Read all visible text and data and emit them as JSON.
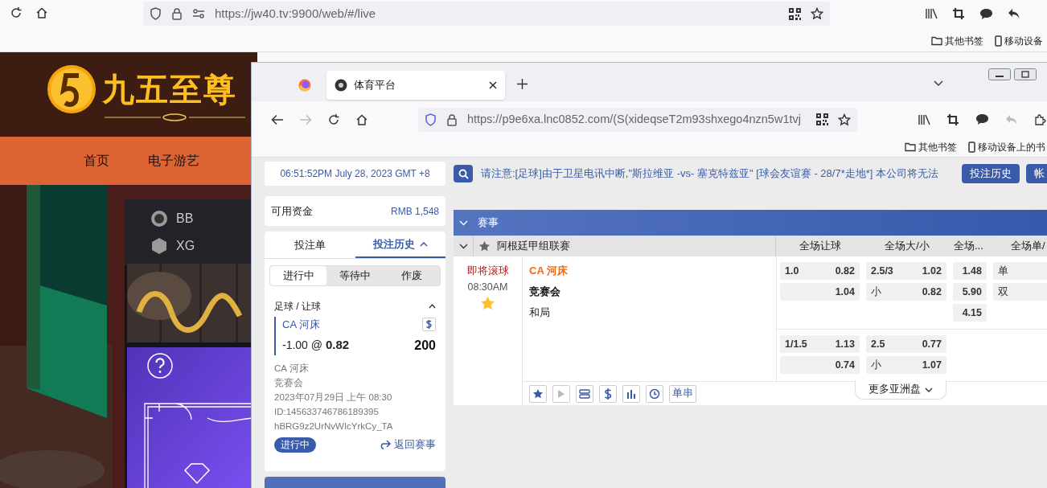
{
  "outer_browser": {
    "url": "https://jw40.tv:9900/web/#/live",
    "bookmarks": [
      "其他书签",
      "移动设备"
    ]
  },
  "site": {
    "brand": "九五至尊",
    "nav": [
      "首页",
      "电子游艺"
    ],
    "providers": [
      "BB",
      "XG"
    ]
  },
  "inner_browser": {
    "tab_title": "体育平台",
    "url": "https://p9e6xa.lnc0852.com/(S(xideqseT2m93shxego4nzn5w1tvj",
    "bookmarks": [
      "其他书签",
      "移动设备上的书"
    ]
  },
  "clock": "06:51:52PM July 28, 2023 GMT +8",
  "notice": "请注意:[足球]由于卫星电讯中断,\"斯拉维亚 -vs- 塞克特兹亚\" [球会友谊赛 - 28/7*走地*] 本公司将无法",
  "header_buttons": [
    "投注历史",
    "帐"
  ],
  "balance": {
    "label": "可用资金",
    "value": "RMB 1,548"
  },
  "slip": {
    "tabs": [
      {
        "label": "投注单",
        "selected": false
      },
      {
        "label": "投注历史",
        "selected": true
      }
    ],
    "filters": [
      {
        "label": "进行中",
        "selected": true
      },
      {
        "label": "等待中",
        "selected": false
      },
      {
        "label": "作废",
        "selected": false
      }
    ],
    "bet": {
      "sport": "足球 / 让球",
      "selection": "CA 河床",
      "line": "-1.00 @",
      "odds": "0.82",
      "stake": "200",
      "details": [
        "CA 河床",
        "竞赛会",
        "2023年07月29日 上午 08:30",
        "ID:145633746786189395",
        "hBRG9z2UrNvWIcYrkCy_TA"
      ],
      "status": "进行中",
      "back": "返回赛事"
    }
  },
  "events": {
    "title": "赛事",
    "league": "阿根廷甲组联赛",
    "columns": [
      "全场让球",
      "全场大/小",
      "全场...",
      "全场单/"
    ],
    "match": {
      "status": "即将滚球",
      "time": "08:30AM",
      "favorite": true,
      "teams": [
        {
          "name": "CA 河床",
          "kind": "home"
        },
        {
          "name": "竞赛会",
          "kind": "away"
        },
        {
          "name": "和局",
          "kind": "draw"
        }
      ],
      "lines": [
        {
          "handicap": [
            {
              "label": "1.0",
              "odds": "0.82"
            },
            {
              "odds": "1.04"
            }
          ],
          "over_under": [
            {
              "label": "2.5/3",
              "odds": "1.02"
            },
            {
              "label": "小",
              "odds": "0.82"
            }
          ],
          "result": [
            "1.48",
            "5.90",
            "4.15"
          ],
          "odd_even": [
            "单",
            "双"
          ]
        },
        {
          "handicap": [
            {
              "label": "1/1.5",
              "odds": "1.13"
            },
            {
              "odds": "0.74"
            }
          ],
          "over_under": [
            {
              "label": "2.5",
              "odds": "0.77"
            },
            {
              "label": "小",
              "odds": "1.07"
            }
          ]
        }
      ],
      "tools": [
        "单串"
      ],
      "more": "更多亚洲盘"
    }
  }
}
